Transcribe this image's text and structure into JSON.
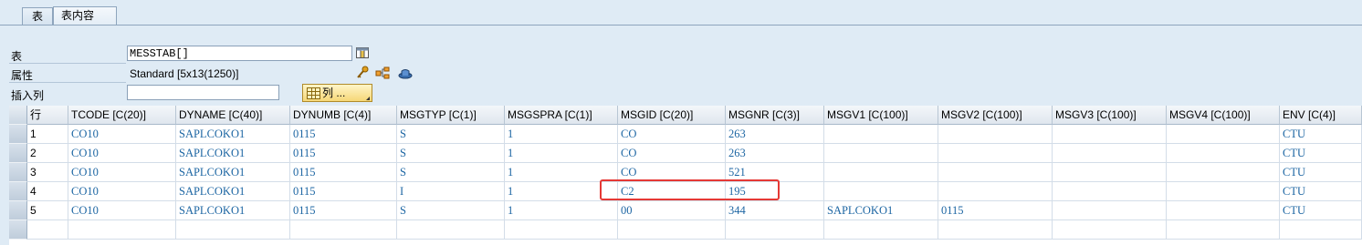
{
  "tabs": [
    {
      "label": "表"
    },
    {
      "label": "表内容"
    }
  ],
  "form": {
    "table_label": "表",
    "table_value": "MESSTAB[]",
    "attr_label": "属性",
    "attr_value": "Standard [5x13(1250)]",
    "insert_label": "插入列",
    "insert_value": "",
    "columns_button": "列 ..."
  },
  "grid": {
    "headers": [
      "行",
      "TCODE [C(20)]",
      "DYNAME [C(40)]",
      "DYNUMB [C(4)]",
      "MSGTYP [C(1)]",
      "MSGSPRA [C(1)]",
      "MSGID [C(20)]",
      "MSGNR [C(3)]",
      "MSGV1 [C(100)]",
      "MSGV2 [C(100)]",
      "MSGV3 [C(100)]",
      "MSGV4 [C(100)]",
      "ENV [C(4)]"
    ],
    "rows": [
      [
        "1",
        "CO10",
        "SAPLCOKO1",
        "0115",
        "S",
        "1",
        "CO",
        "263",
        "",
        "",
        "",
        "",
        "CTU"
      ],
      [
        "2",
        "CO10",
        "SAPLCOKO1",
        "0115",
        "S",
        "1",
        "CO",
        "263",
        "",
        "",
        "",
        "",
        "CTU"
      ],
      [
        "3",
        "CO10",
        "SAPLCOKO1",
        "0115",
        "S",
        "1",
        "CO",
        "521",
        "",
        "",
        "",
        "",
        "CTU"
      ],
      [
        "4",
        "CO10",
        "SAPLCOKO1",
        "0115",
        "I",
        "1",
        "C2",
        "195",
        "",
        "",
        "",
        "",
        "CTU"
      ],
      [
        "5",
        "CO10",
        "SAPLCOKO1",
        "0115",
        "S",
        "1",
        "00",
        "344",
        "SAPLCOKO1",
        "0115",
        "",
        "",
        "CTU"
      ]
    ]
  },
  "colors": {
    "highlight": "#e53935",
    "cell_text": "#1d66a3",
    "background": "#dfebf5"
  }
}
